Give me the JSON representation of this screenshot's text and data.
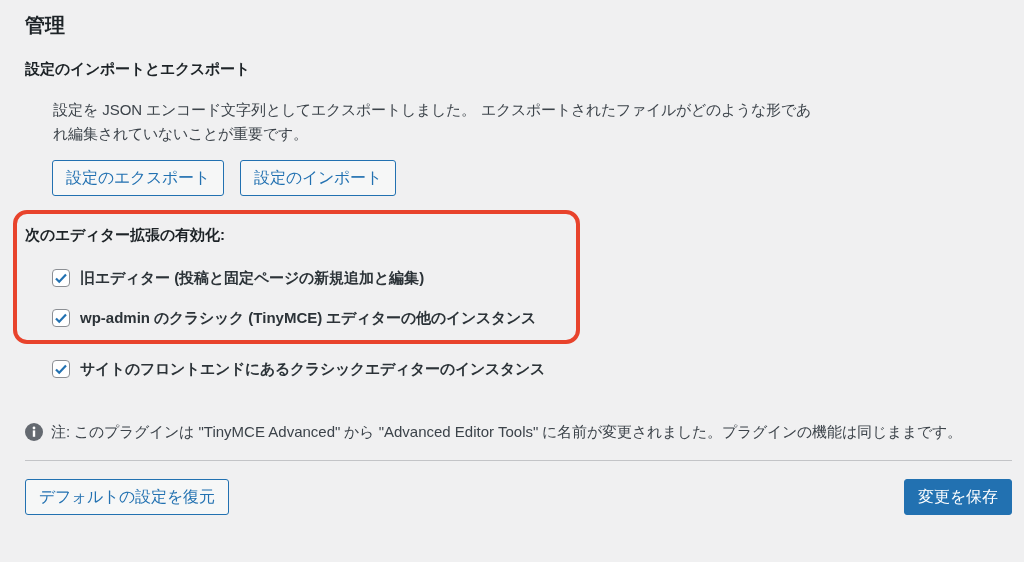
{
  "title": "管理",
  "import_export": {
    "heading": "設定のインポートとエクスポート",
    "description": "設定を JSON エンコード文字列としてエクスポートしました。 エクスポートされたファイルがどのような形であれ編集されていないことが重要です。",
    "buttons": [
      "設定のエクスポート",
      "設定のインポート"
    ]
  },
  "editor_extensions": {
    "highlighted_group": {
      "heading": "次のエディター拡張の有効化:",
      "options": [
        {
          "label": "旧エディター (投稿と固定ページの新規追加と編集)",
          "checked": true
        },
        {
          "label": "wp-admin のクラシック (TinyMCE) エディターの他のインスタンス",
          "checked": true
        }
      ]
    },
    "options": [
      {
        "label": "サイトのフロントエンドにあるクラシックエディターのインスタンス",
        "checked": true
      }
    ]
  },
  "note": "注: このプラグインは \"TinyMCE Advanced\" から \"Advanced Editor Tools\" に名前が変更されました。プラグインの機能は同じままです。",
  "footer": {
    "restore_button": "デフォルトの設定を復元",
    "save_button": "変更を保存"
  }
}
